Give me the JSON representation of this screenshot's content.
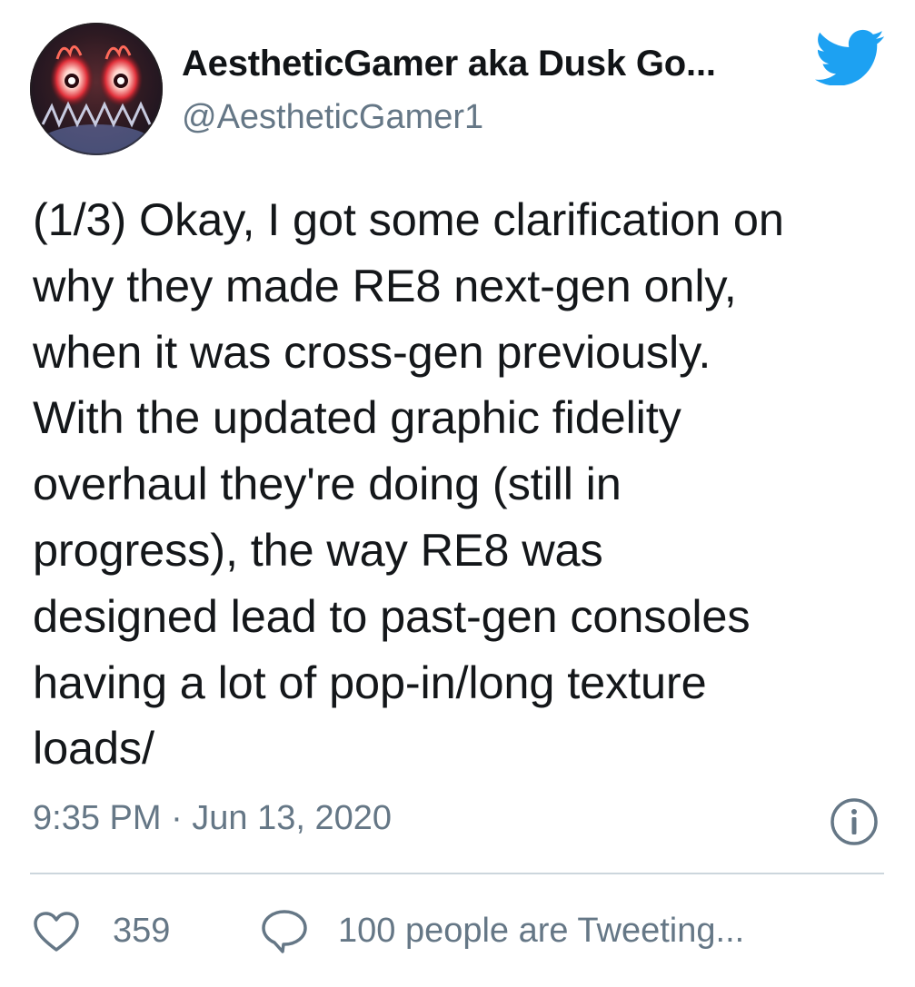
{
  "author": {
    "display_name": "AestheticGamer aka Dusk Go...",
    "handle": "@AestheticGamer1",
    "avatar_icon": "flaming-eyes-avatar",
    "brand_icon": "twitter-bird-icon"
  },
  "tweet": {
    "text": "(1/3) Okay, I got some clarification on\nwhy they made RE8 next-gen only,\nwhen it was cross-gen previously.\nWith the updated graphic fidelity\noverhaul they're doing (still in\nprogress), the way RE8 was\ndesigned lead to past-gen consoles\nhaving a lot of pop-in/long texture\nloads/",
    "timestamp": "9:35 PM · Jun 13, 2020"
  },
  "footer": {
    "like_count": "359",
    "tweeting_text": "100 people are Tweeting..."
  },
  "colors": {
    "twitter_blue": "#1da1f2",
    "muted_text": "#657786",
    "divider": "#ccd6dd",
    "body_text": "#14171a"
  }
}
